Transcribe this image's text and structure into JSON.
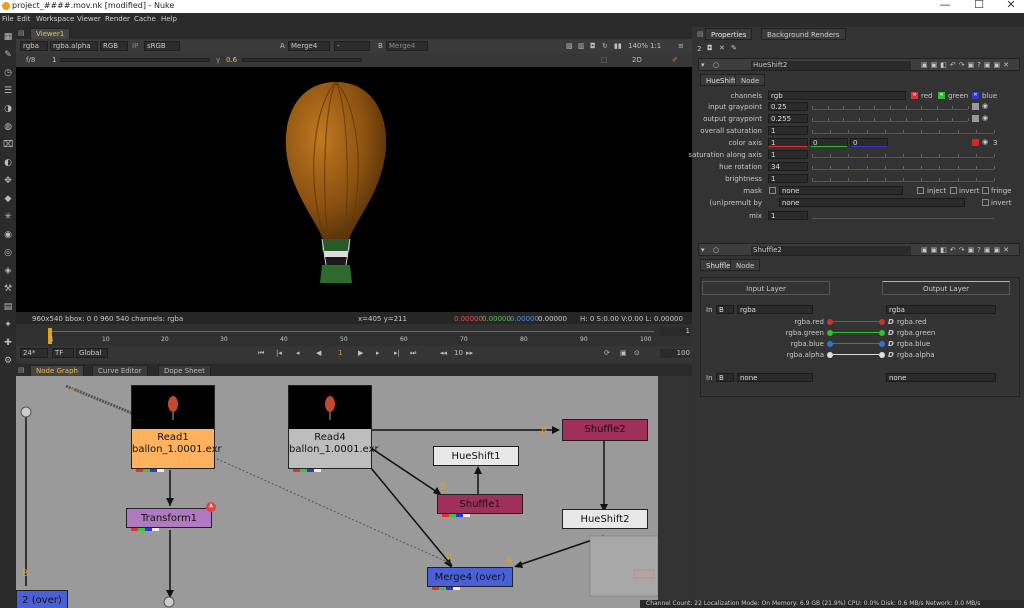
{
  "window": {
    "title": "project_####.mov.nk [modified] - Nuke"
  },
  "menu": [
    "File",
    "Edit",
    "Workspace",
    "Viewer",
    "Render",
    "Cache",
    "Help"
  ],
  "viewer": {
    "tab": "Viewer1",
    "channels": "rgba",
    "alpha_channel": "rgba.alpha",
    "display_mode": "RGB",
    "ip_label": "IP",
    "colorspace": "sRGB",
    "input_a_label": "A",
    "input_a": "Merge4",
    "composite_op": "-",
    "input_b_label": "B",
    "input_b": "Merge4",
    "zoom": "140%",
    "proxy": "1:1",
    "fstop": "f/8",
    "gain_frame": "1",
    "gamma": "0.6",
    "view_mode": "2D",
    "format_info": "960x540  bbox: 0 0 960 540 channels: rgba",
    "coords": "x=405 y=211",
    "pixel_r": "0.00000",
    "pixel_g": "0.00000",
    "pixel_b": "0.00000",
    "pixel_a": "0.00000",
    "hsvl": "H:  0 S:0.00 V:0.00   L: 0.00000"
  },
  "timeline": {
    "ticks": [
      "1",
      "10",
      "20",
      "30",
      "40",
      "50",
      "60",
      "70",
      "80",
      "90",
      "100"
    ],
    "fps": "24*",
    "timecode": "TF",
    "scope": "Global",
    "current_frame": "1",
    "step": "10",
    "end_frame": "100",
    "start_frame": "1",
    "range_end": "100"
  },
  "nodegraph": {
    "tabs": [
      "Node Graph",
      "Curve Editor",
      "Dope Sheet"
    ],
    "nodes": [
      {
        "name": "Read1",
        "sub": "ballon_1.0001.exr"
      },
      {
        "name": "Read4",
        "sub": "ballon_1.0001.exr"
      },
      {
        "name": "Transform1",
        "badge": "A"
      },
      {
        "name": "HueShift1"
      },
      {
        "name": "Shuffle1"
      },
      {
        "name": "Shuffle2"
      },
      {
        "name": "HueShift2"
      },
      {
        "name": "Merge4 (over)"
      },
      {
        "name": "2 (over)"
      }
    ],
    "input_labels": {
      "b": "B",
      "a": "A"
    },
    "dot_label": "2"
  },
  "properties": {
    "tabs": [
      "Properties",
      "Background Renders"
    ],
    "count": "2",
    "hueshift": {
      "node_name": "HueShift2",
      "tabs": [
        "HueShift",
        "Node"
      ],
      "channels_label": "channels",
      "channels_value": "rgb",
      "chk_red": "red",
      "chk_green": "green",
      "chk_blue": "blue",
      "rows": [
        {
          "label": "input graypoint",
          "value": "0.25"
        },
        {
          "label": "output graypoint",
          "value": "0.255"
        },
        {
          "label": "overall saturation",
          "value": "1"
        },
        {
          "label": "color axis",
          "value": "1",
          "v2": "0",
          "v3": "0",
          "count": "3"
        },
        {
          "label": "saturation along axis",
          "value": "1"
        },
        {
          "label": "hue rotation",
          "value": "34"
        },
        {
          "label": "brightness",
          "value": "1"
        }
      ],
      "mask_label": "mask",
      "mask_value": "none",
      "inject": "inject",
      "invert": "invert",
      "fringe": "fringe",
      "premult_label": "(un)premult by",
      "premult_value": "none",
      "premult_invert": "invert",
      "mix_label": "mix",
      "mix_value": "1"
    },
    "shuffle": {
      "node_name": "Shuffle2",
      "tabs": [
        "Shuffle",
        "Node"
      ],
      "input_layer": "Input Layer",
      "output_layer": "Output Layer",
      "in1_port": "In",
      "in1_b": "B",
      "in1_value": "rgba",
      "out1_value": "rgba",
      "mappings": [
        {
          "src": "rgba.red",
          "dst": "rgba.red",
          "color": "#d03030"
        },
        {
          "src": "rgba.green",
          "dst": "rgba.green",
          "color": "#30c030"
        },
        {
          "src": "rgba.blue",
          "dst": "rgba.blue",
          "color": "#3070d0"
        },
        {
          "src": "rgba.alpha",
          "dst": "rgba.alpha",
          "color": "#dddddd"
        }
      ],
      "in2_port": "In",
      "in2_b": "B",
      "in2_value": "none",
      "out2_value": "none"
    }
  },
  "status": "Channel Count: 22  Localization Mode: On  Memory: 6.9 GB (21.9%)  CPU: 0.0%  Disk: 0.6 MB/s  Network: 0.0 MB/s"
}
